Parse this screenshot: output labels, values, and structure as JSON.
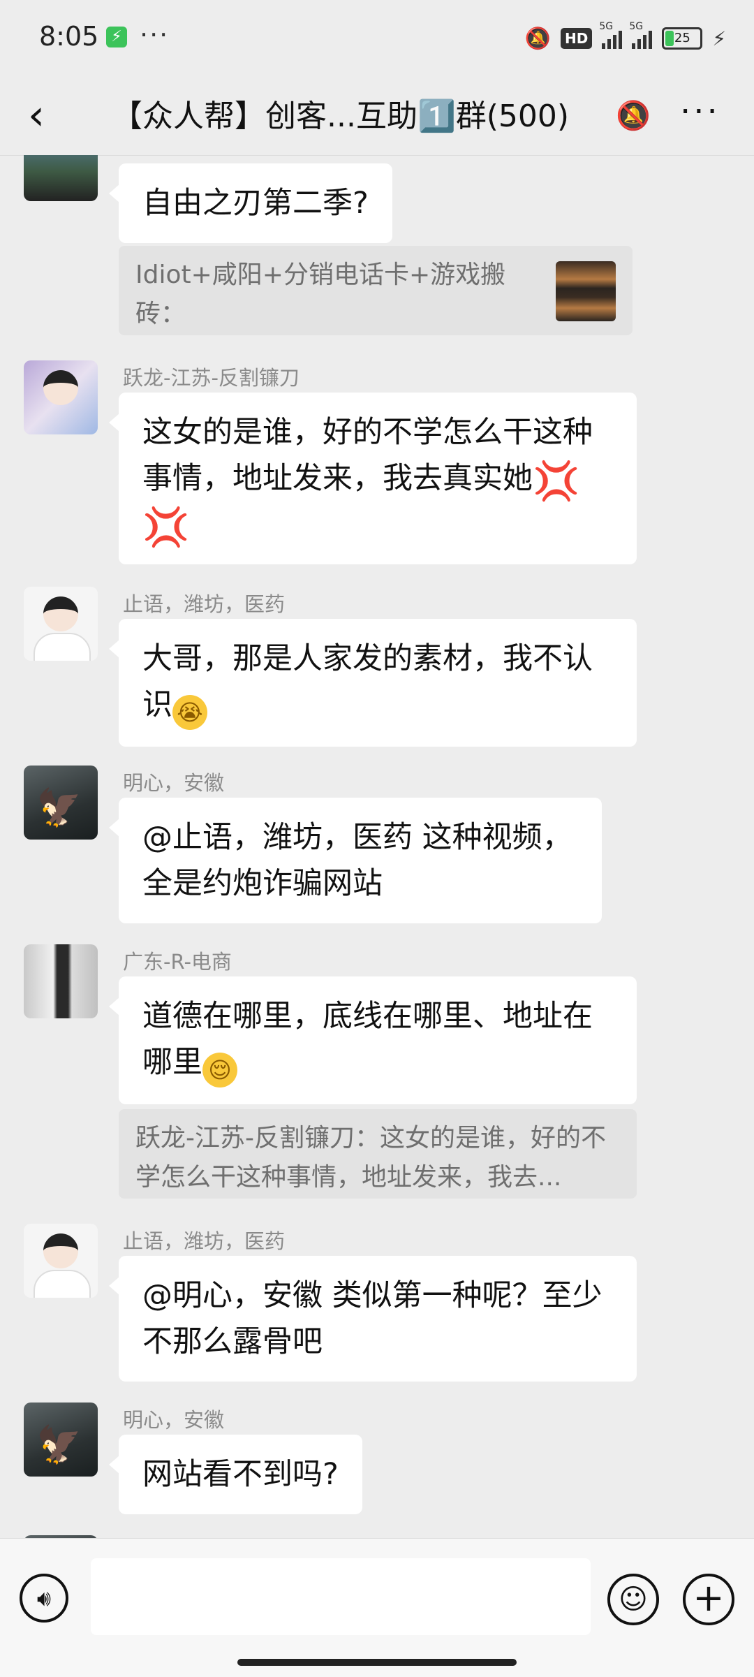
{
  "status_bar": {
    "time": "8:05",
    "dots": "···",
    "hd_label": "HD",
    "net1": "5G",
    "net2": "5G",
    "battery_percent": "25",
    "battery_level": 0.25,
    "icons": [
      "app-notification-icon",
      "mute-vibrate-icon",
      "signal-icon",
      "battery-icon",
      "charging-icon"
    ]
  },
  "nav": {
    "title": "【众人帮】创客...互助1️⃣群(500)",
    "icons": [
      "back-icon",
      "muted-bell-icon",
      "more-icon"
    ]
  },
  "messages": [
    {
      "type": "bubble",
      "sender": "",
      "text": "自由之刃第二季?"
    },
    {
      "type": "quote",
      "text": "Idiot+咸阳+分销电话卡+游戏搬砖："
    },
    {
      "type": "bubble",
      "sender": "跃龙-江苏-反割镰刀",
      "text": "这女的是谁，好的不学怎么干这种事情，地址发来，我去真实她"
    },
    {
      "type": "bubble",
      "sender": "止语，潍坊，医药",
      "text": "大哥，那是人家发的素材，我不认识"
    },
    {
      "type": "bubble",
      "sender": "明心，安徽",
      "text": "@止语，潍坊，医药  这种视频，全是约炮诈骗网站"
    },
    {
      "type": "bubble",
      "sender": "广东-R-电商",
      "text": "道德在哪里，底线在哪里、地址在哪里"
    },
    {
      "type": "quote",
      "text": "跃龙-江苏-反割镰刀：这女的是谁，好的不学怎么干这种事情，地址发来，我去..."
    },
    {
      "type": "bubble",
      "sender": "止语，潍坊，医药",
      "text": "@明心，安徽  类似第一种呢？至少不那么露骨吧"
    },
    {
      "type": "bubble",
      "sender": "明心，安徽",
      "text": "网站看不到吗?"
    }
  ],
  "input_bar": {
    "placeholder": "",
    "icons": [
      "voice-icon",
      "emoji-icon",
      "plus-icon"
    ]
  },
  "colors": {
    "background": "#ededed",
    "bubble": "#ffffff",
    "quote": "#e3e3e3",
    "sender_name": "#8a8a8a"
  }
}
